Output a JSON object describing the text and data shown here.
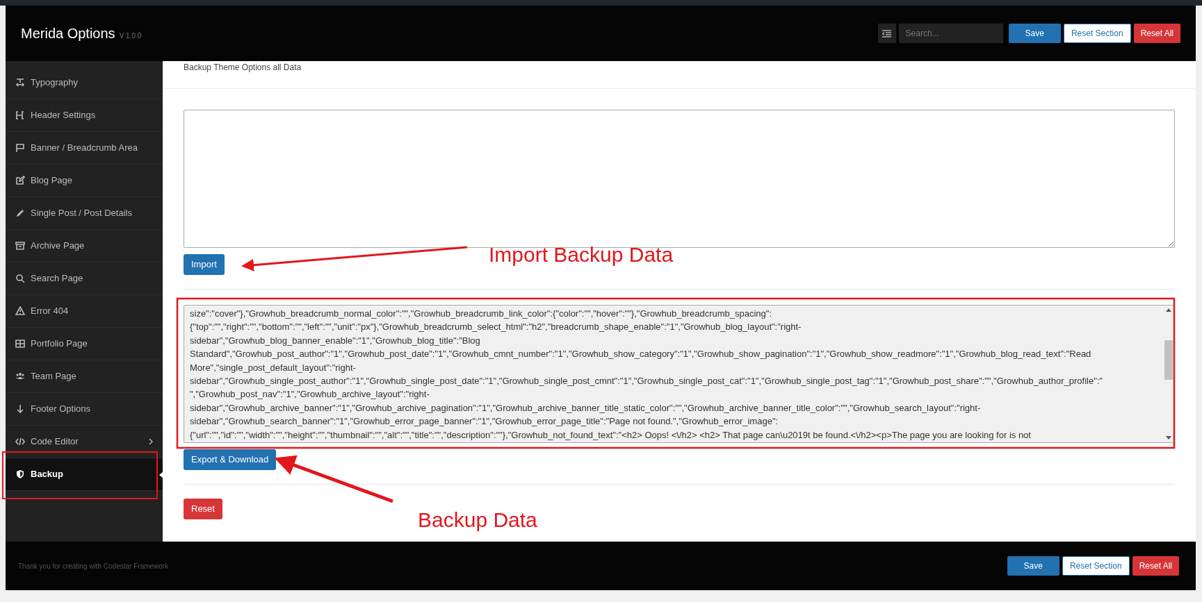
{
  "header": {
    "title": "Merida Options",
    "version": "V 1.0.0",
    "search": {
      "placeholder": "Search..."
    },
    "buttons": [
      {
        "label": "Save",
        "kind": "primary"
      },
      {
        "label": "Reset Section",
        "kind": "outline"
      },
      {
        "label": "Reset All",
        "kind": "danger"
      }
    ]
  },
  "sidebar": {
    "items": [
      {
        "label": "Typography",
        "selected": false,
        "has_children": false
      },
      {
        "label": "Header Settings",
        "selected": false,
        "has_children": false
      },
      {
        "label": "Banner / Breadcrumb Area",
        "selected": false,
        "has_children": false
      },
      {
        "label": "Blog Page",
        "selected": false,
        "has_children": false
      },
      {
        "label": "Single Post / Post Details",
        "selected": false,
        "has_children": false
      },
      {
        "label": "Archive Page",
        "selected": false,
        "has_children": false
      },
      {
        "label": "Search Page",
        "selected": false,
        "has_children": false
      },
      {
        "label": "Error 404",
        "selected": false,
        "has_children": false
      },
      {
        "label": "Portfolio Page",
        "selected": false,
        "has_children": false
      },
      {
        "label": "Team Page",
        "selected": false,
        "has_children": false
      },
      {
        "label": "Footer Options",
        "selected": false,
        "has_children": false
      },
      {
        "label": "Code Editor",
        "selected": false,
        "has_children": true
      },
      {
        "label": "Backup",
        "selected": true,
        "has_children": false
      }
    ]
  },
  "content": {
    "description": "Backup Theme Options all Data",
    "import_button": "Import",
    "export_lines": [
      "size\":\"cover\"},\"Growhub_breadcrumb_normal_color\":\"\",\"Growhub_breadcrumb_link_color\":{\"color\":\"\",\"hover\":\"\"},\"Growhub_breadcrumb_spacing\":",
      "{\"top\":\"\",\"right\":\"\",\"bottom\":\"\",\"left\":\"\",\"unit\":\"px\"},\"Growhub_breadcrumb_select_html\":\"h2\",\"breadcrumb_shape_enable\":\"1\",\"Growhub_blog_layout\":\"right-",
      "sidebar\",\"Growhub_blog_banner_enable\":\"1\",\"Growhub_blog_title\":\"Blog",
      "Standard\",\"Growhub_post_author\":\"1\",\"Growhub_post_date\":\"1\",\"Growhub_cmnt_number\":\"1\",\"Growhub_show_category\":\"1\",\"Growhub_show_pagination\":\"1\",\"Growhub_show_readmore\":\"1\",\"Growhub_blog_read_text\":\"Read",
      "More\",\"single_post_default_layout\":\"right-",
      "sidebar\",\"Growhub_single_post_author\":\"1\",\"Growhub_single_post_date\":\"1\",\"Growhub_single_post_cmnt\":\"1\",\"Growhub_single_post_cat\":\"1\",\"Growhub_single_post_tag\":\"1\",\"Growhub_post_share\":\"\",\"Growhub_author_profile\":\"",
      "\",\"Growhub_post_nav\":\"1\",\"Growhub_archive_layout\":\"right-",
      "sidebar\",\"Growhub_archive_banner\":\"1\",\"Growhub_archive_pagination\":\"1\",\"Growhub_archive_banner_title_static_color\":\"\",\"Growhub_archive_banner_title_color\":\"\",\"Growhub_search_layout\":\"right-",
      "sidebar\",\"Growhub_search_banner\":\"1\",\"Growhub_error_page_banner\":\"1\",\"Growhub_error_page_title\":\"Page not found.\",\"Growhub_error_image\":",
      "{\"url\":\"\",\"id\":\"\",\"width\":\"\",\"height\":\"\",\"thumbnail\":\"\",\"alt\":\"\",\"title\":\"\",\"description\":\"\"},\"Growhub_not_found_text\":\"<h2> Oops! <\\/h2> <h2> That page can\\u2019t be found.<\\/h2><p>The page you are looking for is not"
    ],
    "export_button": "Export & Download",
    "reset_button": "Reset"
  },
  "annotations": [
    {
      "text": "Import Backup Data"
    },
    {
      "text": "Backup Data"
    }
  ],
  "footer": {
    "credit": "Thank you for creating with Codestar Framework",
    "buttons": [
      {
        "label": "Save",
        "kind": "primary"
      },
      {
        "label": "Reset Section",
        "kind": "outline"
      },
      {
        "label": "Reset All",
        "kind": "danger"
      }
    ]
  }
}
